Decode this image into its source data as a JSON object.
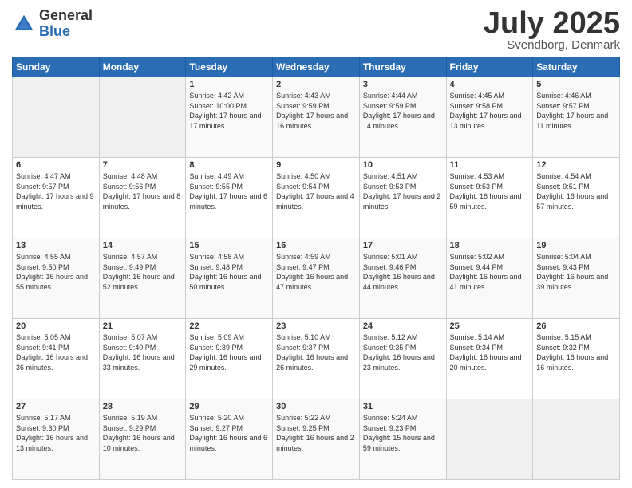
{
  "header": {
    "logo_general": "General",
    "logo_blue": "Blue",
    "month": "July 2025",
    "location": "Svendborg, Denmark"
  },
  "days_of_week": [
    "Sunday",
    "Monday",
    "Tuesday",
    "Wednesday",
    "Thursday",
    "Friday",
    "Saturday"
  ],
  "weeks": [
    [
      {
        "day": "",
        "info": ""
      },
      {
        "day": "",
        "info": ""
      },
      {
        "day": "1",
        "info": "Sunrise: 4:42 AM\nSunset: 10:00 PM\nDaylight: 17 hours and 17 minutes."
      },
      {
        "day": "2",
        "info": "Sunrise: 4:43 AM\nSunset: 9:59 PM\nDaylight: 17 hours and 16 minutes."
      },
      {
        "day": "3",
        "info": "Sunrise: 4:44 AM\nSunset: 9:59 PM\nDaylight: 17 hours and 14 minutes."
      },
      {
        "day": "4",
        "info": "Sunrise: 4:45 AM\nSunset: 9:58 PM\nDaylight: 17 hours and 13 minutes."
      },
      {
        "day": "5",
        "info": "Sunrise: 4:46 AM\nSunset: 9:57 PM\nDaylight: 17 hours and 11 minutes."
      }
    ],
    [
      {
        "day": "6",
        "info": "Sunrise: 4:47 AM\nSunset: 9:57 PM\nDaylight: 17 hours and 9 minutes."
      },
      {
        "day": "7",
        "info": "Sunrise: 4:48 AM\nSunset: 9:56 PM\nDaylight: 17 hours and 8 minutes."
      },
      {
        "day": "8",
        "info": "Sunrise: 4:49 AM\nSunset: 9:55 PM\nDaylight: 17 hours and 6 minutes."
      },
      {
        "day": "9",
        "info": "Sunrise: 4:50 AM\nSunset: 9:54 PM\nDaylight: 17 hours and 4 minutes."
      },
      {
        "day": "10",
        "info": "Sunrise: 4:51 AM\nSunset: 9:53 PM\nDaylight: 17 hours and 2 minutes."
      },
      {
        "day": "11",
        "info": "Sunrise: 4:53 AM\nSunset: 9:53 PM\nDaylight: 16 hours and 59 minutes."
      },
      {
        "day": "12",
        "info": "Sunrise: 4:54 AM\nSunset: 9:51 PM\nDaylight: 16 hours and 57 minutes."
      }
    ],
    [
      {
        "day": "13",
        "info": "Sunrise: 4:55 AM\nSunset: 9:50 PM\nDaylight: 16 hours and 55 minutes."
      },
      {
        "day": "14",
        "info": "Sunrise: 4:57 AM\nSunset: 9:49 PM\nDaylight: 16 hours and 52 minutes."
      },
      {
        "day": "15",
        "info": "Sunrise: 4:58 AM\nSunset: 9:48 PM\nDaylight: 16 hours and 50 minutes."
      },
      {
        "day": "16",
        "info": "Sunrise: 4:59 AM\nSunset: 9:47 PM\nDaylight: 16 hours and 47 minutes."
      },
      {
        "day": "17",
        "info": "Sunrise: 5:01 AM\nSunset: 9:46 PM\nDaylight: 16 hours and 44 minutes."
      },
      {
        "day": "18",
        "info": "Sunrise: 5:02 AM\nSunset: 9:44 PM\nDaylight: 16 hours and 41 minutes."
      },
      {
        "day": "19",
        "info": "Sunrise: 5:04 AM\nSunset: 9:43 PM\nDaylight: 16 hours and 39 minutes."
      }
    ],
    [
      {
        "day": "20",
        "info": "Sunrise: 5:05 AM\nSunset: 9:41 PM\nDaylight: 16 hours and 36 minutes."
      },
      {
        "day": "21",
        "info": "Sunrise: 5:07 AM\nSunset: 9:40 PM\nDaylight: 16 hours and 33 minutes."
      },
      {
        "day": "22",
        "info": "Sunrise: 5:09 AM\nSunset: 9:39 PM\nDaylight: 16 hours and 29 minutes."
      },
      {
        "day": "23",
        "info": "Sunrise: 5:10 AM\nSunset: 9:37 PM\nDaylight: 16 hours and 26 minutes."
      },
      {
        "day": "24",
        "info": "Sunrise: 5:12 AM\nSunset: 9:35 PM\nDaylight: 16 hours and 23 minutes."
      },
      {
        "day": "25",
        "info": "Sunrise: 5:14 AM\nSunset: 9:34 PM\nDaylight: 16 hours and 20 minutes."
      },
      {
        "day": "26",
        "info": "Sunrise: 5:15 AM\nSunset: 9:32 PM\nDaylight: 16 hours and 16 minutes."
      }
    ],
    [
      {
        "day": "27",
        "info": "Sunrise: 5:17 AM\nSunset: 9:30 PM\nDaylight: 16 hours and 13 minutes."
      },
      {
        "day": "28",
        "info": "Sunrise: 5:19 AM\nSunset: 9:29 PM\nDaylight: 16 hours and 10 minutes."
      },
      {
        "day": "29",
        "info": "Sunrise: 5:20 AM\nSunset: 9:27 PM\nDaylight: 16 hours and 6 minutes."
      },
      {
        "day": "30",
        "info": "Sunrise: 5:22 AM\nSunset: 9:25 PM\nDaylight: 16 hours and 2 minutes."
      },
      {
        "day": "31",
        "info": "Sunrise: 5:24 AM\nSunset: 9:23 PM\nDaylight: 15 hours and 59 minutes."
      },
      {
        "day": "",
        "info": ""
      },
      {
        "day": "",
        "info": ""
      }
    ]
  ]
}
